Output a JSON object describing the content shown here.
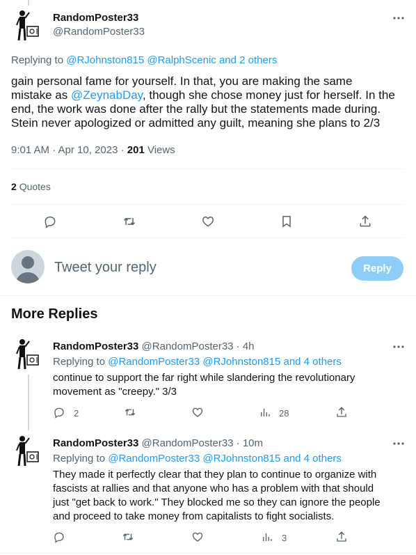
{
  "main_tweet": {
    "display_name": "RandomPoster33",
    "handle": "@RandomPoster33",
    "replying_prefix": "Replying to",
    "replying_mentions": "@RJohnston815 @RalphScenic",
    "replying_and": "and 2 others",
    "line1": "gain personal fame for yourself. In that, you are making the same",
    "line2_pre": "mistake as",
    "line2_mention": "@ZeynabDay",
    "line2_post": ", though she chose money just for herself. In the",
    "line3": "end, the work was done after the rally but the statements made during.",
    "line4": "Stein never apologized or admitted any guilt, meaning she plans to 2/3",
    "timestamp": "9:01 AM · Apr 10, 2023 ·",
    "views_count": "201",
    "views_label": "Views",
    "quotes_count": "2",
    "quotes_label": "Quotes"
  },
  "composer": {
    "placeholder": "Tweet your reply",
    "button_label": "Reply"
  },
  "more_replies_heading": "More Replies",
  "replies": [
    {
      "display_name": "RandomPoster33",
      "handle_time": "@RandomPoster33 · 4h",
      "replying_prefix": "Replying to",
      "replying_mentions": "@RandomPoster33 @RJohnston815 and 4 others",
      "line1": "continue to support the far right while slandering the revolutionary",
      "line2": "movement as \"creepy.\" 3/3",
      "reply_count": "2",
      "views_count": "28"
    },
    {
      "display_name": "RandomPoster33",
      "handle_time": "@RandomPoster33 · 10m",
      "replying_prefix": "Replying to",
      "replying_mentions": "@RandomPoster33 @RJohnston815 and 4 others",
      "line1": "They made it perfectly clear that they plan to continue to organize with",
      "line2": "fascists at rallies and that anyone who has a problem with that should",
      "line3": "just \"get back to work.\" They blocked me so they can ignore the people",
      "line4": "and proceed to take money from capitalists to fight socialists.",
      "views_count": "3"
    }
  ],
  "colors": {
    "accent": "#1d9bf0",
    "reply_button_disabled": "#8ecdf8",
    "secondary_text": "#536471",
    "divider": "#eff3f4"
  },
  "icons": [
    "more-icon",
    "reply-icon",
    "retweet-icon",
    "like-icon",
    "bookmark-icon",
    "share-icon",
    "views-icon",
    "default-avatar-icon"
  ]
}
